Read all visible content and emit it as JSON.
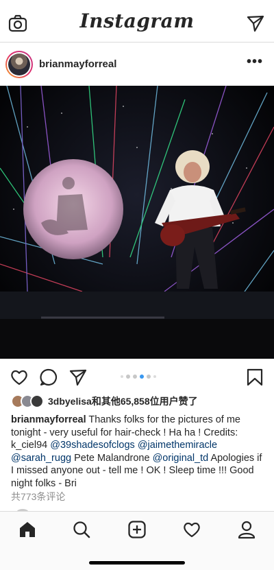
{
  "header": {
    "app_title": "Instagram",
    "camera_icon": "camera-icon",
    "direct_icon": "paper-plane-icon"
  },
  "post": {
    "username": "brianmayforreal",
    "more_icon": "more-horizontal-icon",
    "more_glyph": "•••",
    "carousel": {
      "count": 6,
      "active_index": 3
    },
    "likes_text": "3dbyelisa和其他65,858位用户赞了",
    "caption": {
      "username": "brianmayforreal",
      "text_1": " Thanks folks for the pictures of me tonight - very useful for hair-check ! Ha ha !  Credits: k_ciel94 ",
      "mention_1": "@39shadesofclogs",
      "space_1": " ",
      "mention_2": "@jaimethemiracle",
      "space_2": " ",
      "mention_3": "@sarah_rugg",
      "text_2": "  Pete Malandrone ",
      "mention_4": "@original_td",
      "text_3": " Apologies if I missed anyone out - tell me !  OK ! Sleep time !!! Good night folks - Bri"
    },
    "comments_link": "共773条评论"
  },
  "tabbar": {
    "tabs": [
      "home-icon",
      "search-icon",
      "new-post-icon",
      "activity-heart-icon",
      "profile-icon"
    ]
  },
  "colors": {
    "text": "#262626",
    "mention": "#003569",
    "muted": "#8e8e8e",
    "active_dot": "#3897f0",
    "border": "#dbdbdb"
  }
}
